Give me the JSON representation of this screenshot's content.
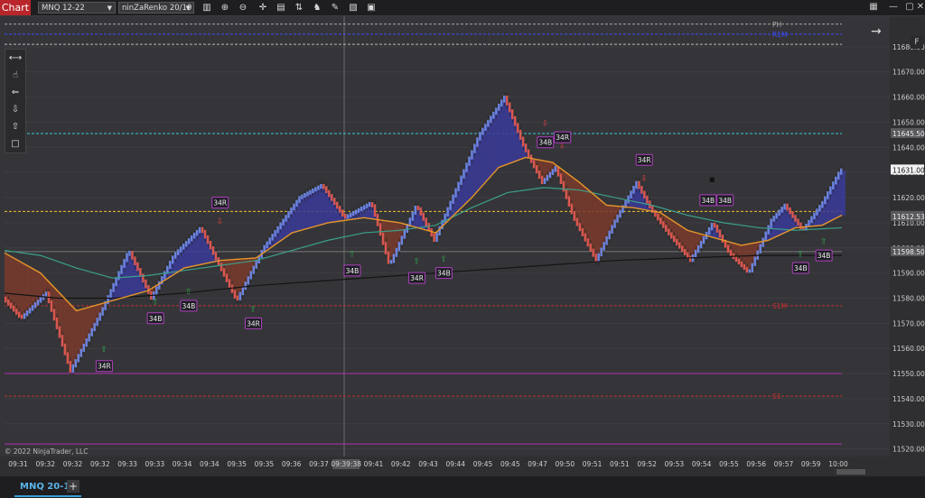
{
  "app": {
    "title": "Chart"
  },
  "toolbar": {
    "instrument": "MNQ 12-22",
    "bar_type": "ninZaRenko 20/10",
    "icons": [
      "bars-icon",
      "zoom-in-icon",
      "zoom-out-icon",
      "crosshair-icon",
      "properties-icon",
      "data-series-icon",
      "strategies-icon",
      "drawing-tools-icon",
      "templates-icon",
      "screenshot-icon"
    ]
  },
  "window_controls": [
    "menu-icon",
    "minimize-icon",
    "maximize-icon",
    "close-icon"
  ],
  "panel_button": "F",
  "copyright": "© 2022 NinjaTrader, LLC",
  "tabs": [
    {
      "label": "MNQ 20-10"
    }
  ],
  "colors": {
    "up": "#6b84e0",
    "down": "#d9574f",
    "cloud_up": "#3a3a9a",
    "cloud_down": "#7a3a2c",
    "ema_fast": "#e6962a",
    "ema_slow": "#3aa08a",
    "bg": "#353539"
  },
  "chart_data": {
    "type": "candlestick-renko",
    "ylim": [
      11517,
      11690
    ],
    "y_ticks": [
      11520,
      11530,
      11540,
      11550,
      11560,
      11570,
      11580,
      11590,
      11600,
      11610,
      11620,
      11630,
      11640,
      11650,
      11660,
      11670,
      11680
    ],
    "price_markers": [
      {
        "label": "11645.50",
        "value": 11645.5,
        "color": "#5a5a5e"
      },
      {
        "label": "11631.00",
        "value": 11631,
        "color": "#f2f2f2"
      },
      {
        "label": "11612.53",
        "value": 11612.53,
        "color": "#5a5a5e"
      },
      {
        "label": "11598.50",
        "value": 11598.5,
        "color": "#5a5a5e"
      }
    ],
    "levels": [
      {
        "label": "PH",
        "value": 11689,
        "color": "#aaaaaa",
        "style": "dashed"
      },
      {
        "label": "R1M",
        "value": 11685,
        "color": "#3a4aff",
        "style": "dashed"
      },
      {
        "label": "",
        "value": 11681,
        "color": "#bbbbbb",
        "style": "dashed"
      },
      {
        "label": "",
        "value": 11645.5,
        "color": "#3ac8d8",
        "style": "dashed"
      },
      {
        "label": "",
        "value": 11614.5,
        "color": "#f0c030",
        "style": "dashed"
      },
      {
        "label": "",
        "value": 11598.5,
        "color": "#777777",
        "style": "solid"
      },
      {
        "label": "S1M",
        "value": 11577,
        "color": "#c03030",
        "style": "dashed"
      },
      {
        "label": "",
        "value": 11550,
        "color": "#b030b0",
        "style": "solid"
      },
      {
        "label": "S1",
        "value": 11541,
        "color": "#c03030",
        "style": "dashed"
      },
      {
        "label": "",
        "value": 11522,
        "color": "#b030b0",
        "style": "solid"
      }
    ],
    "x_labels": [
      "09:31",
      "09:32",
      "09:32",
      "09:32",
      "09:33",
      "09:33",
      "09:34",
      "09:34",
      "09:35",
      "09:35",
      "09:36",
      "09:37",
      "09:39:38",
      "09:41",
      "09:42",
      "09:43",
      "09:44",
      "09:45",
      "09:45",
      "09:47",
      "09:50",
      "09:51",
      "09:51",
      "09:52",
      "09:53",
      "09:54",
      "09:55",
      "09:56",
      "09:57",
      "09:59",
      "10:00"
    ],
    "path": [
      [
        0,
        11580
      ],
      [
        20,
        11572
      ],
      [
        48,
        11582
      ],
      [
        75,
        11551
      ],
      [
        110,
        11575
      ],
      [
        140,
        11599
      ],
      [
        165,
        11580
      ],
      [
        190,
        11597
      ],
      [
        220,
        11608
      ],
      [
        260,
        11579
      ],
      [
        290,
        11600
      ],
      [
        330,
        11620
      ],
      [
        355,
        11625
      ],
      [
        380,
        11612
      ],
      [
        410,
        11618
      ],
      [
        430,
        11593
      ],
      [
        460,
        11617
      ],
      [
        480,
        11603
      ],
      [
        505,
        11624
      ],
      [
        530,
        11645
      ],
      [
        558,
        11660
      ],
      [
        580,
        11640
      ],
      [
        600,
        11626
      ],
      [
        615,
        11632
      ],
      [
        635,
        11612
      ],
      [
        660,
        11595
      ],
      [
        680,
        11610
      ],
      [
        705,
        11626
      ],
      [
        722,
        11615
      ],
      [
        740,
        11606
      ],
      [
        765,
        11595
      ],
      [
        790,
        11610
      ],
      [
        808,
        11598
      ],
      [
        830,
        11590
      ],
      [
        855,
        11611
      ],
      [
        870,
        11617
      ],
      [
        890,
        11607
      ],
      [
        912,
        11618
      ],
      [
        932,
        11631
      ]
    ],
    "ema_fast": [
      [
        0,
        11598
      ],
      [
        40,
        11590
      ],
      [
        80,
        11575
      ],
      [
        120,
        11579
      ],
      [
        160,
        11583
      ],
      [
        200,
        11592
      ],
      [
        240,
        11595
      ],
      [
        280,
        11596
      ],
      [
        320,
        11606
      ],
      [
        360,
        11610
      ],
      [
        400,
        11612
      ],
      [
        440,
        11610
      ],
      [
        480,
        11606
      ],
      [
        520,
        11620
      ],
      [
        550,
        11632
      ],
      [
        580,
        11636
      ],
      [
        610,
        11634
      ],
      [
        640,
        11626
      ],
      [
        670,
        11617
      ],
      [
        700,
        11616
      ],
      [
        730,
        11614
      ],
      [
        760,
        11607
      ],
      [
        790,
        11604
      ],
      [
        820,
        11601
      ],
      [
        850,
        11603
      ],
      [
        880,
        11608
      ],
      [
        910,
        11609
      ],
      [
        932,
        11613
      ]
    ],
    "ema_slow": [
      [
        0,
        11599
      ],
      [
        40,
        11597
      ],
      [
        80,
        11592
      ],
      [
        120,
        11588
      ],
      [
        160,
        11589
      ],
      [
        200,
        11591
      ],
      [
        240,
        11593
      ],
      [
        280,
        11595
      ],
      [
        320,
        11599
      ],
      [
        360,
        11603
      ],
      [
        400,
        11606
      ],
      [
        440,
        11607
      ],
      [
        480,
        11609
      ],
      [
        520,
        11616
      ],
      [
        560,
        11622
      ],
      [
        600,
        11624
      ],
      [
        640,
        11623
      ],
      [
        680,
        11620
      ],
      [
        720,
        11617
      ],
      [
        760,
        11613
      ],
      [
        800,
        11610
      ],
      [
        840,
        11608
      ],
      [
        880,
        11607
      ],
      [
        932,
        11608
      ]
    ],
    "vwap": [
      [
        0,
        11582
      ],
      [
        60,
        11580
      ],
      [
        120,
        11580
      ],
      [
        200,
        11582
      ],
      [
        280,
        11585
      ],
      [
        360,
        11587
      ],
      [
        440,
        11589
      ],
      [
        520,
        11591
      ],
      [
        600,
        11593
      ],
      [
        680,
        11595
      ],
      [
        760,
        11596
      ],
      [
        840,
        11597
      ],
      [
        932,
        11597
      ]
    ],
    "markers": [
      {
        "label": "34R",
        "x": 240,
        "y": 11618,
        "arrow": "down",
        "arrow_y": 11611
      },
      {
        "label": "34B",
        "x": 168,
        "y": 11572,
        "arrow": "up",
        "arrow_y": 11579
      },
      {
        "label": "34B",
        "x": 205,
        "y": 11577,
        "arrow": "up",
        "arrow_y": 11583
      },
      {
        "label": "34R",
        "x": 277,
        "y": 11570,
        "arrow": "up",
        "arrow_y": 11576
      },
      {
        "label": "34R",
        "x": 111,
        "y": 11553,
        "arrow": "up",
        "arrow_y": 11560
      },
      {
        "label": "34B",
        "x": 387,
        "y": 11591,
        "arrow": "up",
        "arrow_y": 11598
      },
      {
        "label": "34R",
        "x": 459,
        "y": 11588,
        "arrow": "up",
        "arrow_y": 11595
      },
      {
        "label": "34B",
        "x": 489,
        "y": 11590,
        "arrow": "up",
        "arrow_y": 11596
      },
      {
        "label": "34B",
        "x": 602,
        "y": 11642,
        "arrow": "down",
        "arrow_y": 11650
      },
      {
        "label": "34R",
        "x": 621,
        "y": 11644,
        "arrow": "down",
        "arrow_y": 11641
      },
      {
        "label": "34R",
        "x": 712,
        "y": 11635,
        "arrow": "down",
        "arrow_y": 11628
      },
      {
        "label": "34B",
        "x": 783,
        "y": 11619,
        "arrow": "none",
        "arrow_y": 11619
      },
      {
        "label": "34B",
        "x": 802,
        "y": 11619,
        "arrow": "none",
        "arrow_y": 11619
      },
      {
        "label": "34B",
        "x": 886,
        "y": 11592,
        "arrow": "up",
        "arrow_y": 11598
      },
      {
        "label": "34B",
        "x": 912,
        "y": 11597,
        "arrow": "up",
        "arrow_y": 11603
      }
    ]
  }
}
